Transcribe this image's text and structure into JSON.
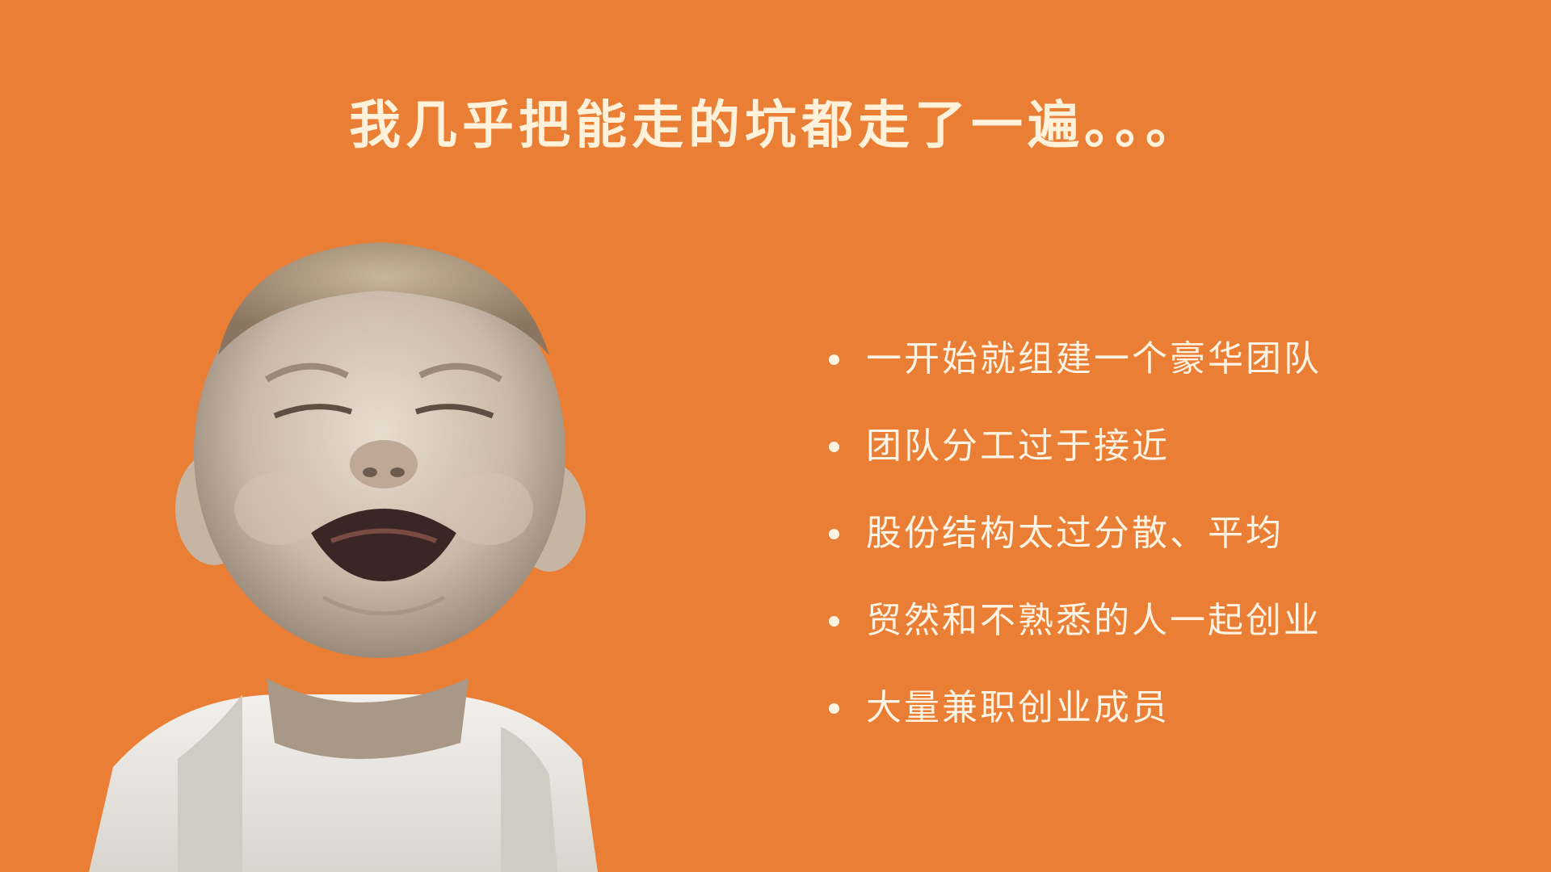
{
  "slide": {
    "title": "我几乎把能走的坑都走了一遍。。。",
    "background_color": "#E97E34",
    "text_color": "#FFF3E3",
    "photo": {
      "subject": "crying-baby-photo"
    },
    "bullets": [
      "一开始就组建一个豪华团队",
      "团队分工过于接近",
      "股份结构太过分散、平均",
      "贸然和不熟悉的人一起创业",
      "大量兼职创业成员"
    ]
  }
}
